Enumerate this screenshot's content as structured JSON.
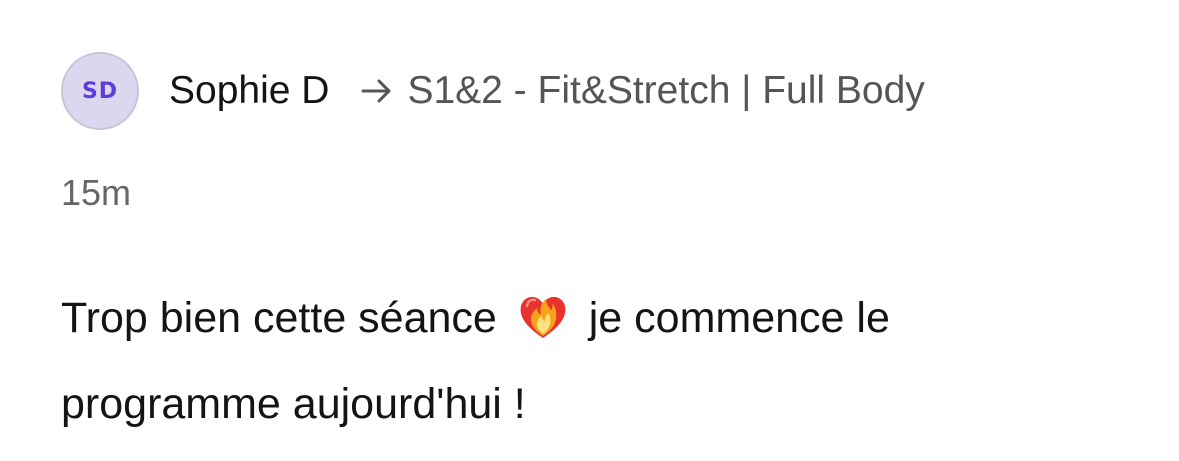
{
  "post": {
    "avatar_initials": "SD",
    "author": "Sophie D",
    "arrow_icon": "arrow-right-icon",
    "target": "S1&2 - Fit&Stretch | Full Body",
    "time": "15m",
    "message_before": "Trop bien cette séance",
    "emoji": "heart-on-fire-icon",
    "message_after": "je commence le programme aujourd'hui !"
  },
  "colors": {
    "avatar_bg": "#dcd6ee",
    "avatar_text": "#5b3fd6",
    "heart_red": "#e8322e",
    "fire_orange": "#f7a21b"
  }
}
